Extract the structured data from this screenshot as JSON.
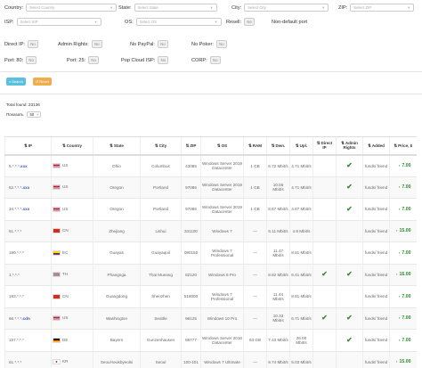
{
  "filters": {
    "country": {
      "label": "Country:",
      "placeholder": "Select Country"
    },
    "state": {
      "label": "State:",
      "placeholder": "Select State"
    },
    "city": {
      "label": "City:",
      "placeholder": "Select City"
    },
    "zip": {
      "label": "ZIP:",
      "placeholder": "Select ZIP"
    },
    "isp": {
      "label": "ISP:",
      "placeholder": "Select ISP"
    },
    "os": {
      "label": "OS:",
      "placeholder": "Select OS"
    },
    "resell": {
      "label": "Resell:",
      "value": "No"
    },
    "non_default_port": {
      "label": "Non-default port"
    },
    "direct_ip": {
      "label": "Direct IP:",
      "value": "No"
    },
    "admin_rights": {
      "label": "Admin Rights:",
      "value": "No"
    },
    "no_paypal": {
      "label": "No PayPal:",
      "value": "No"
    },
    "no_poker": {
      "label": "No Poker:",
      "value": "No"
    },
    "port80": {
      "label": "Port: 80:",
      "value": "No"
    },
    "port25": {
      "label": "Port: 25:",
      "value": "No"
    },
    "pop_cloud_isp": {
      "label": "Pop Cloud ISP:",
      "value": "No"
    },
    "corp": {
      "label": "CORP:",
      "value": "No"
    }
  },
  "buttons": {
    "search": "Search",
    "reset": "Reset"
  },
  "summary": {
    "total_found": "Total found: 23136",
    "show_label": "Показать",
    "show_value": "50"
  },
  "colors": {
    "search_btn": "#5bc0de",
    "reset_btn": "#f0ad4e",
    "price": "#2e8b2e",
    "check": "#3a8a3a",
    "link": "#3a5ab0"
  },
  "columns": [
    "IP",
    "Country",
    "State",
    "City",
    "ZIP",
    "OS",
    "RAM",
    "Dwn.",
    "Upl.",
    "Direct IP",
    "Admin Rights",
    "Added",
    "Price, $"
  ],
  "rows": [
    {
      "ip": "5.*.*.*",
      "ext": ".xxx",
      "flag": "us",
      "country": "US",
      "state": "Ohio",
      "city": "Columbus",
      "zip": "43085",
      "os": "Windows Server 2019 Datacenter",
      "ram": "1 GB",
      "dwn": "6.72 Mbit/s",
      "upl": "4.71 Mbit/s",
      "direct": false,
      "admin": true,
      "added": "funds/ friend",
      "price": "7.00"
    },
    {
      "ip": "52.*.*.*",
      "ext": ".xxx",
      "flag": "us",
      "country": "US",
      "state": "Oregon",
      "city": "Portland",
      "zip": "97086",
      "os": "Windows Server 2019 Datacenter",
      "ram": "1 GB",
      "dwn": "10.56 Mbit/s",
      "upl": "4.71 Mbit/s",
      "direct": false,
      "admin": true,
      "added": "funds/ friend",
      "price": "7.00"
    },
    {
      "ip": "34.*.*.*",
      "ext": ".xxx",
      "flag": "us",
      "country": "US",
      "state": "Oregon",
      "city": "Portland",
      "zip": "97086",
      "os": "Windows Server 2019 Datacenter",
      "ram": "1 GB",
      "dwn": "8.67 Mbit/s",
      "upl": "4.87 Mbit/s",
      "direct": false,
      "admin": true,
      "added": "funds/ friend",
      "price": "7.00"
    },
    {
      "ip": "61.*.*.*",
      "ext": "",
      "flag": "cn",
      "country": "CN",
      "state": "Zhejiang",
      "city": "Lishui",
      "zip": "331100",
      "os": "Windows 7",
      "ram": "—",
      "dwn": "6.11 Mbit/s",
      "upl": "4.8 Mbit/s",
      "direct": false,
      "admin": false,
      "added": "funds/ friend",
      "price": "15.00"
    },
    {
      "ip": "190.*.*.*",
      "ext": "",
      "flag": "ec",
      "country": "EC",
      "state": "Guayas",
      "city": "Guayaquil",
      "zip": "090150",
      "os": "Windows 7 Professional",
      "ram": "—",
      "dwn": "11.47 Mbit/s",
      "upl": "8.81 Mbit/s",
      "direct": false,
      "admin": false,
      "added": "funds/ friend",
      "price": "7.00"
    },
    {
      "ip": "1.*.*.*",
      "ext": "",
      "flag": "th",
      "country": "TH",
      "state": "Phangnga",
      "city": "Thai Mueang",
      "zip": "82120",
      "os": "Windows 8 Pro",
      "ram": "—",
      "dwn": "8.62 Mbit/s",
      "upl": "6.41 Mbit/s",
      "direct": true,
      "admin": true,
      "added": "funds/ friend",
      "price": "16.00"
    },
    {
      "ip": "183.*.*.*",
      "ext": "",
      "flag": "cn",
      "country": "CN",
      "state": "Guangdong",
      "city": "Shenzhen",
      "zip": "518000",
      "os": "Windows 7 Professional",
      "ram": "—",
      "dwn": "11.44 Mbit/s",
      "upl": "8.81 Mbit/s",
      "direct": false,
      "admin": false,
      "added": "funds/ friend",
      "price": "7.00"
    },
    {
      "ip": "66.*.*.*",
      "ext": ".cdn",
      "flag": "us",
      "country": "US",
      "state": "Washington",
      "city": "Seattle",
      "zip": "98125",
      "os": "Windows 10 Pro",
      "ram": "—",
      "dwn": "10.33 Mbit/s",
      "upl": "6.71 Mbit/s",
      "direct": true,
      "admin": true,
      "added": "funds/ friend",
      "price": "7.00"
    },
    {
      "ip": "157.*.*.*",
      "ext": "",
      "flag": "de",
      "country": "DE",
      "state": "Bayern",
      "city": "Gunzenhausen",
      "zip": "85777",
      "os": "Windows Server 2016 Datacenter",
      "ram": "63 GB",
      "dwn": "7.43 Mbit/s",
      "upl": "26.00 Mbit/s",
      "direct": false,
      "admin": true,
      "added": "funds/ friend",
      "price": "7.00"
    },
    {
      "ip": "61.*.*.*",
      "ext": "",
      "flag": "kr",
      "country": "KR",
      "state": "Seoul-teukbyeolsi",
      "city": "Seoul",
      "zip": "100-101",
      "os": "Windows 7 Ultimate",
      "ram": "—",
      "dwn": "9.74 Mbit/s",
      "upl": "5.03 Mbit/s",
      "direct": false,
      "admin": false,
      "added": "funds/ friend",
      "price": "15.00"
    }
  ]
}
